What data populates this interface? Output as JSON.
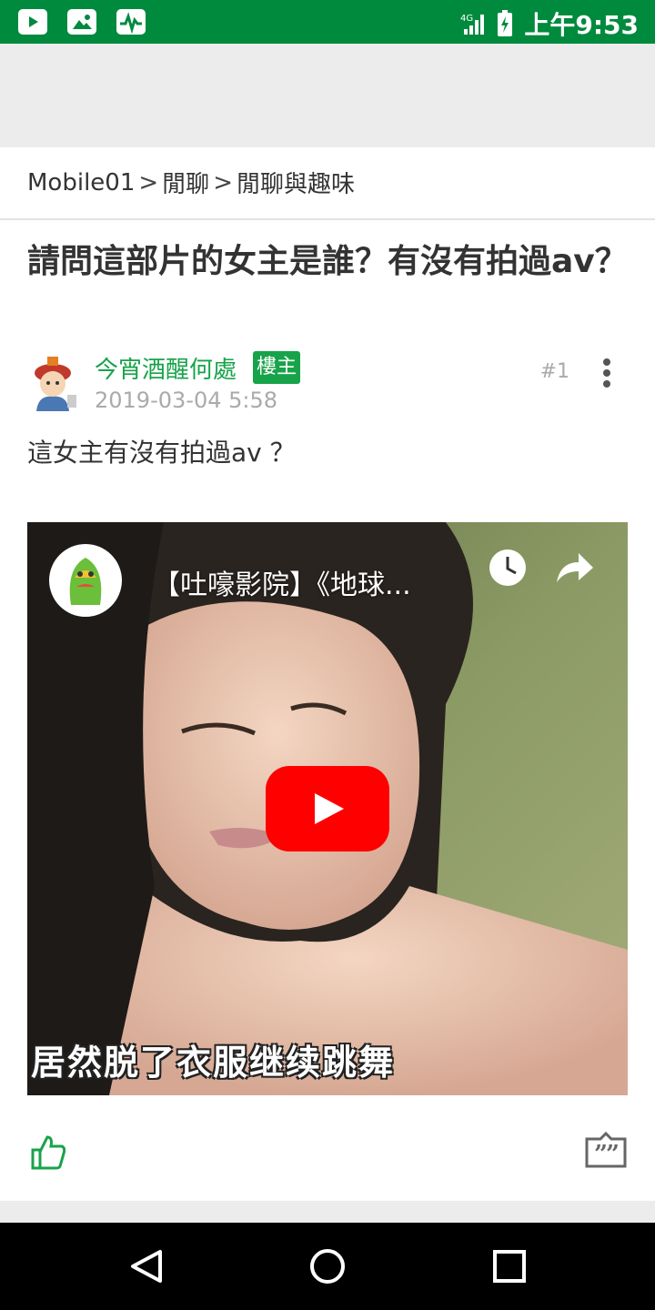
{
  "status_bar": {
    "icons": [
      "youtube-icon",
      "image-icon",
      "activity-icon"
    ],
    "network": "4G",
    "time": "上午9:53",
    "color": "#008a3e"
  },
  "breadcrumb": {
    "items": [
      "Mobile01",
      "閒聊",
      "閒聊與趣味"
    ],
    "separator": ">"
  },
  "post": {
    "title": "請問這部片的女主是誰？有沒有拍過av？",
    "author": "今宵酒醒何處",
    "badge": "樓主",
    "date": "2019-03-04 5:58",
    "floor": "#1",
    "body": "這女主有沒有拍過av ？"
  },
  "video": {
    "title": "【吐嚎影院】《地球...",
    "subtitle": "居然脱了衣服继续跳舞",
    "play_color": "#ff0000"
  },
  "accent_color": "#17a34a"
}
